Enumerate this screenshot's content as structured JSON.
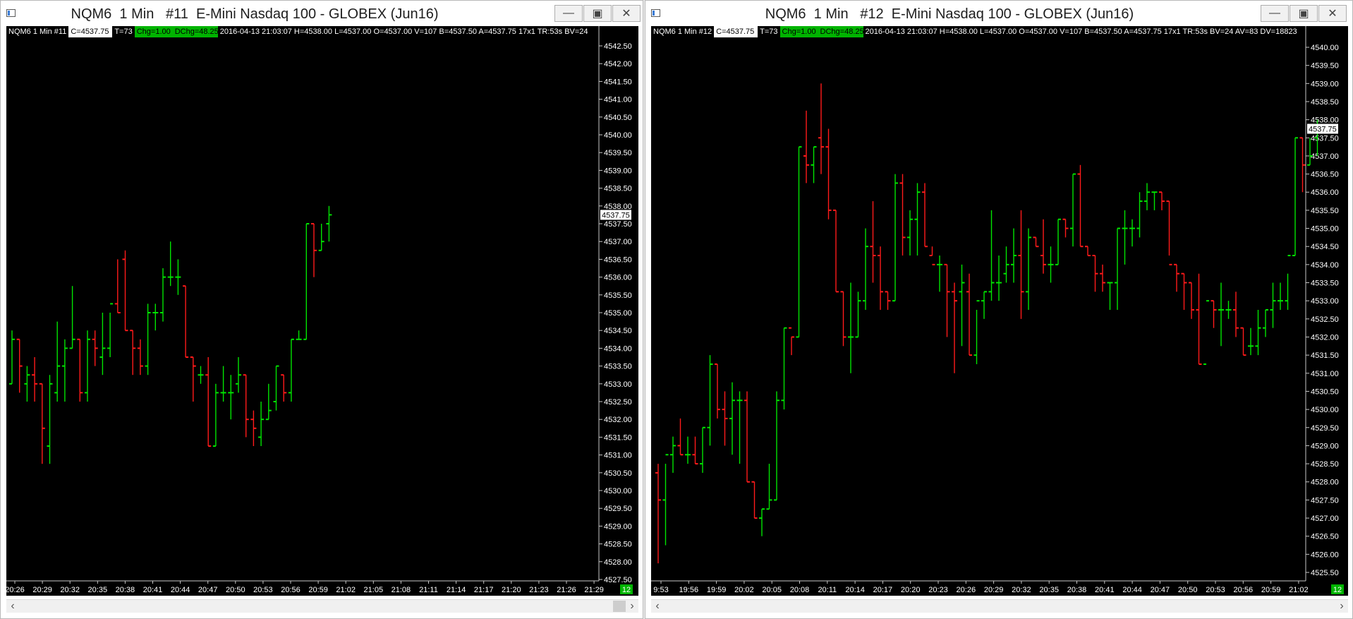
{
  "colors": {
    "up": "#00e400",
    "down": "#ff1a1a",
    "chart_bg": "#000000",
    "axis_text": "#ffffff",
    "badge": "#00b400"
  },
  "windows": [
    {
      "title": "NQM6  1 Min   #11  E-Mini Nasdaq 100 - GLOBEX (Jun16)",
      "info": {
        "symbol": "NQM6  1 Min   #11",
        "close": "C=4537.75",
        "ticks": "T=73",
        "chg": "Chg=1.00",
        "dchg": "DChg=48.25",
        "rest": "2016-04-13 21:03:07 H=4538.00 L=4537.00 O=4537.00 V=107 B=4537.50 A=4537.75 17x1 TR:53s BV=24"
      },
      "price_label": "4537.75",
      "badge": "12",
      "chart_data": {
        "type": "candlestick-ohlc",
        "ylim": [
          4527.5,
          4542.5
        ],
        "y_ticks": [
          "4542.50",
          "4542.00",
          "4541.50",
          "4541.00",
          "4540.50",
          "4540.00",
          "4539.50",
          "4539.00",
          "4538.50",
          "4538.00",
          "4537.50",
          "4537.00",
          "4536.50",
          "4536.00",
          "4535.50",
          "4535.00",
          "4534.50",
          "4534.00",
          "4533.50",
          "4533.00",
          "4532.50",
          "4532.00",
          "4531.50",
          "4531.00",
          "4530.50",
          "4530.00",
          "4529.50",
          "4529.00",
          "4528.50",
          "4528.00",
          "4527.50"
        ],
        "x_labels": [
          "20:26",
          "20:29",
          "20:32",
          "20:35",
          "20:38",
          "20:41",
          "20:44",
          "20:47",
          "20:50",
          "20:53",
          "20:56",
          "20:59",
          "21:02",
          "21:05",
          "21:08",
          "21:11",
          "21:14",
          "21:17",
          "21:20",
          "21:23",
          "21:26",
          "21:29"
        ],
        "bars": [
          [
            4533.0,
            4534.5,
            4533.0,
            4534.25
          ],
          [
            4534.25,
            4534.25,
            4532.75,
            4533.5
          ],
          [
            4533.0,
            4533.5,
            4532.5,
            4533.25
          ],
          [
            4533.25,
            4533.75,
            4532.5,
            4533.0
          ],
          [
            4533.0,
            4533.0,
            4530.75,
            4531.75
          ],
          [
            4531.25,
            4533.25,
            4530.75,
            4533.0
          ],
          [
            4532.75,
            4534.75,
            4532.5,
            4533.5
          ],
          [
            4533.5,
            4534.25,
            4532.5,
            4534.0
          ],
          [
            4534.0,
            4535.75,
            4534.0,
            4534.25
          ],
          [
            4534.25,
            4534.25,
            4532.5,
            4532.75
          ],
          [
            4532.75,
            4534.5,
            4532.5,
            4534.25
          ],
          [
            4534.25,
            4534.5,
            4533.5,
            4534.0
          ],
          [
            4533.75,
            4535.0,
            4533.25,
            4534.0
          ],
          [
            4534.0,
            4535.0,
            4533.75,
            4535.25
          ],
          [
            4535.25,
            4536.5,
            4535.0,
            4535.0
          ],
          [
            4536.5,
            4536.75,
            4534.5,
            4534.5
          ],
          [
            4534.5,
            4534.5,
            4533.25,
            4534.0
          ],
          [
            4534.0,
            4534.25,
            4533.25,
            4533.5
          ],
          [
            4533.5,
            4535.25,
            4533.25,
            4535.0
          ],
          [
            4535.0,
            4535.25,
            4534.5,
            4535.0
          ],
          [
            4535.0,
            4536.25,
            4534.75,
            4536.0
          ],
          [
            4536.0,
            4537.0,
            4535.75,
            4536.0
          ],
          [
            4536.0,
            4536.5,
            4535.5,
            4536.0
          ],
          [
            4535.75,
            4535.75,
            4533.75,
            4533.75
          ],
          [
            4533.75,
            4533.75,
            4532.5,
            4533.5
          ],
          [
            4533.25,
            4533.5,
            4533.0,
            4533.25
          ],
          [
            4533.25,
            4533.75,
            4531.25,
            4531.25
          ],
          [
            4531.25,
            4533.0,
            4531.25,
            4532.75
          ],
          [
            4532.75,
            4533.5,
            4532.5,
            4532.75
          ],
          [
            4532.75,
            4533.25,
            4532.0,
            4532.75
          ],
          [
            4533.0,
            4533.75,
            4532.75,
            4533.25
          ],
          [
            4533.25,
            4533.25,
            4531.5,
            4532.0
          ],
          [
            4532.0,
            4532.25,
            4531.25,
            4531.75
          ],
          [
            4531.5,
            4532.5,
            4531.25,
            4532.0
          ],
          [
            4532.0,
            4533.0,
            4532.0,
            4532.25
          ],
          [
            4532.5,
            4533.5,
            4532.25,
            4533.5
          ],
          [
            4533.25,
            4533.25,
            4532.5,
            4532.75
          ],
          [
            4532.75,
            4534.25,
            4532.5,
            4534.25
          ],
          [
            4534.25,
            4534.5,
            4534.25,
            4534.25
          ],
          [
            4534.25,
            4537.5,
            4534.25,
            4537.5
          ],
          [
            4537.5,
            4537.5,
            4536.0,
            4536.75
          ],
          [
            4536.75,
            4537.5,
            4536.75,
            4537.0
          ],
          [
            4537.5,
            4538.0,
            4537.0,
            4537.75
          ]
        ]
      }
    },
    {
      "title": "NQM6  1 Min   #12  E-Mini Nasdaq 100 - GLOBEX (Jun16)",
      "info": {
        "symbol": "NQM6  1 Min   #12",
        "close": "C=4537.75",
        "ticks": "T=73",
        "chg": "Chg=1.00",
        "dchg": "DChg=48.25",
        "rest": "2016-04-13 21:03:07 H=4538.00 L=4537.00 O=4537.00 V=107 B=4537.50 A=4537.75 17x1 TR:53s BV=24 AV=83 DV=18823"
      },
      "price_label": "4537.75",
      "badge": "12",
      "chart_data": {
        "type": "candlestick-ohlc",
        "ylim": [
          4525.5,
          4540.0
        ],
        "y_ticks": [
          "4540.00",
          "4539.50",
          "4539.00",
          "4538.50",
          "4538.00",
          "4537.50",
          "4537.00",
          "4536.50",
          "4536.00",
          "4535.50",
          "4535.00",
          "4534.50",
          "4534.00",
          "4533.50",
          "4533.00",
          "4532.50",
          "4532.00",
          "4531.50",
          "4531.00",
          "4530.50",
          "4530.00",
          "4529.50",
          "4529.00",
          "4528.50",
          "4528.00",
          "4527.50",
          "4527.00",
          "4526.50",
          "4526.00",
          "4525.50"
        ],
        "x_labels": [
          "9:53",
          "19:56",
          "19:59",
          "20:02",
          "20:05",
          "20:08",
          "20:11",
          "20:14",
          "20:17",
          "20:20",
          "20:23",
          "20:26",
          "20:29",
          "20:32",
          "20:35",
          "20:38",
          "20:41",
          "20:44",
          "20:47",
          "20:50",
          "20:53",
          "20:56",
          "20:59",
          "21:02"
        ],
        "bars": [
          [
            4528.25,
            4528.5,
            4525.75,
            4527.5
          ],
          [
            4527.5,
            4528.5,
            4526.25,
            4528.75
          ],
          [
            4528.75,
            4529.25,
            4528.25,
            4529.0
          ],
          [
            4529.0,
            4529.75,
            4528.75,
            4528.75
          ],
          [
            4528.75,
            4529.25,
            4528.5,
            4528.75
          ],
          [
            4528.75,
            4529.25,
            4528.5,
            4528.5
          ],
          [
            4528.5,
            4529.5,
            4528.25,
            4529.5
          ],
          [
            4529.5,
            4531.5,
            4529.0,
            4531.25
          ],
          [
            4531.25,
            4531.25,
            4529.75,
            4530.0
          ],
          [
            4530.0,
            4530.5,
            4529.0,
            4529.75
          ],
          [
            4529.75,
            4530.75,
            4528.75,
            4530.25
          ],
          [
            4530.25,
            4530.5,
            4528.5,
            4530.25
          ],
          [
            4530.25,
            4530.5,
            4528.0,
            4528.0
          ],
          [
            4528.0,
            4528.0,
            4527.0,
            4527.0
          ],
          [
            4527.0,
            4527.25,
            4526.5,
            4527.25
          ],
          [
            4527.25,
            4528.5,
            4527.25,
            4527.5
          ],
          [
            4527.5,
            4530.5,
            4527.5,
            4530.25
          ],
          [
            4530.25,
            4532.25,
            4530.0,
            4532.25
          ],
          [
            4532.25,
            4532.0,
            4531.5,
            4532.0
          ],
          [
            4532.0,
            4537.25,
            4532.0,
            4537.25
          ],
          [
            4537.0,
            4538.25,
            4536.25,
            4536.75
          ],
          [
            4536.75,
            4537.25,
            4536.25,
            4537.25
          ],
          [
            4537.5,
            4539.0,
            4536.5,
            4537.25
          ],
          [
            4537.25,
            4537.75,
            4535.25,
            4535.5
          ],
          [
            4535.5,
            4535.5,
            4533.25,
            4533.25
          ],
          [
            4533.25,
            4533.25,
            4531.75,
            4532.0
          ],
          [
            4532.0,
            4533.5,
            4531.0,
            4532.0
          ],
          [
            4532.0,
            4533.25,
            4532.0,
            4533.0
          ],
          [
            4533.0,
            4535.0,
            4532.75,
            4534.5
          ],
          [
            4534.5,
            4535.75,
            4533.5,
            4534.25
          ],
          [
            4534.25,
            4534.5,
            4532.75,
            4533.25
          ],
          [
            4533.25,
            4533.25,
            4532.75,
            4533.0
          ],
          [
            4533.0,
            4536.5,
            4533.0,
            4536.25
          ],
          [
            4536.25,
            4536.5,
            4534.25,
            4534.75
          ],
          [
            4534.75,
            4535.5,
            4534.25,
            4535.25
          ],
          [
            4535.25,
            4536.25,
            4534.25,
            4536.0
          ],
          [
            4536.0,
            4536.25,
            4534.5,
            4534.5
          ],
          [
            4534.25,
            4534.5,
            4534.25,
            4534.0
          ],
          [
            4534.0,
            4534.25,
            4533.25,
            4534.0
          ],
          [
            4534.0,
            4534.0,
            4532.0,
            4533.25
          ],
          [
            4533.25,
            4533.5,
            4531.0,
            4533.0
          ],
          [
            4533.25,
            4534.0,
            4531.75,
            4533.5
          ],
          [
            4533.25,
            4533.75,
            4531.5,
            4531.5
          ],
          [
            4531.5,
            4532.75,
            4531.25,
            4533.0
          ],
          [
            4533.0,
            4533.25,
            4532.5,
            4533.25
          ],
          [
            4533.25,
            4535.5,
            4533.0,
            4533.5
          ],
          [
            4533.5,
            4534.25,
            4533.0,
            4533.5
          ],
          [
            4533.75,
            4534.5,
            4533.5,
            4534.0
          ],
          [
            4534.0,
            4535.0,
            4533.5,
            4534.25
          ],
          [
            4534.25,
            4535.5,
            4532.5,
            4533.25
          ],
          [
            4533.25,
            4535.0,
            4532.75,
            4534.75
          ],
          [
            4534.75,
            4534.75,
            4534.5,
            4534.5
          ],
          [
            4534.25,
            4535.25,
            4533.75,
            4534.0
          ],
          [
            4534.0,
            4534.5,
            4533.5,
            4534.0
          ],
          [
            4534.0,
            4535.25,
            4534.0,
            4535.25
          ],
          [
            4535.25,
            4535.25,
            4534.75,
            4535.0
          ],
          [
            4535.0,
            4536.5,
            4534.5,
            4536.5
          ],
          [
            4536.5,
            4536.75,
            4534.5,
            4534.5
          ],
          [
            4534.5,
            4534.5,
            4534.25,
            4534.25
          ],
          [
            4534.25,
            4534.25,
            4533.25,
            4533.75
          ],
          [
            4533.75,
            4534.0,
            4533.25,
            4533.5
          ],
          [
            4533.5,
            4533.5,
            4532.75,
            4533.5
          ],
          [
            4533.5,
            4535.0,
            4532.75,
            4535.0
          ],
          [
            4535.0,
            4535.5,
            4534.0,
            4535.0
          ],
          [
            4535.0,
            4535.25,
            4534.5,
            4535.0
          ],
          [
            4535.0,
            4536.0,
            4534.75,
            4535.75
          ],
          [
            4535.75,
            4536.25,
            4535.5,
            4536.0
          ],
          [
            4536.0,
            4536.0,
            4535.5,
            4536.0
          ],
          [
            4536.0,
            4536.0,
            4535.5,
            4535.75
          ],
          [
            4535.75,
            4535.75,
            4534.25,
            4534.0
          ],
          [
            4534.0,
            4534.0,
            4533.25,
            4533.75
          ],
          [
            4533.75,
            4533.75,
            4532.75,
            4533.5
          ],
          [
            4533.5,
            4533.5,
            4532.5,
            4532.75
          ],
          [
            4532.75,
            4533.75,
            4531.25,
            4531.25
          ],
          [
            4531.25,
            4531.25,
            4531.25,
            4533.0
          ],
          [
            4533.0,
            4533.0,
            4532.25,
            4532.75
          ],
          [
            4532.75,
            4533.5,
            4531.75,
            4532.75
          ],
          [
            4532.75,
            4533.0,
            4532.5,
            4532.75
          ],
          [
            4532.75,
            4533.25,
            4532.0,
            4532.25
          ],
          [
            4532.25,
            4532.25,
            4531.5,
            4531.5
          ],
          [
            4531.75,
            4532.25,
            4531.5,
            4531.75
          ],
          [
            4531.75,
            4532.75,
            4531.5,
            4532.25
          ],
          [
            4532.25,
            4532.75,
            4532.0,
            4532.75
          ],
          [
            4532.75,
            4533.5,
            4532.25,
            4533.0
          ],
          [
            4533.0,
            4533.5,
            4532.75,
            4533.0
          ],
          [
            4533.0,
            4533.75,
            4532.75,
            4534.25
          ],
          [
            4534.25,
            4537.5,
            4534.25,
            4537.5
          ],
          [
            4537.5,
            4537.5,
            4536.0,
            4536.75
          ],
          [
            4536.75,
            4537.5,
            4536.75,
            4537.0
          ],
          [
            4537.5,
            4538.0,
            4537.0,
            4537.75
          ]
        ]
      }
    }
  ]
}
